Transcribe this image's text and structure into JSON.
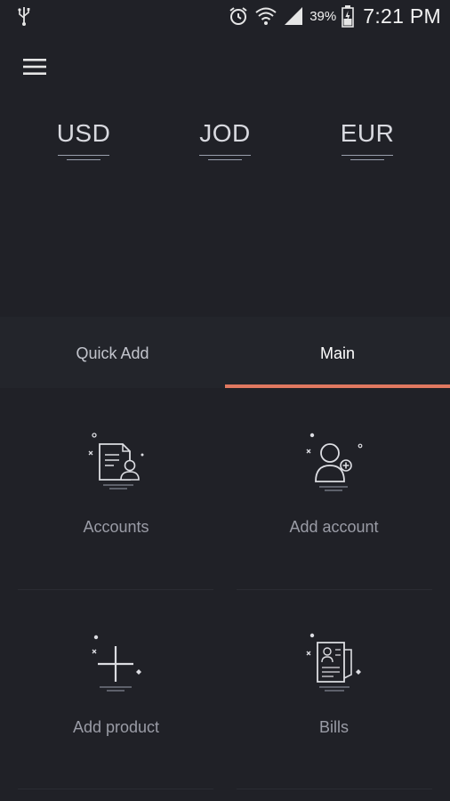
{
  "status_bar": {
    "battery_percent": "39%",
    "time": "7:21 PM",
    "icons": [
      "usb-icon",
      "alarm-icon",
      "wifi-icon",
      "signal-icon",
      "battery-icon"
    ]
  },
  "header": {
    "menu_icon": "hamburger-menu-icon",
    "currencies": [
      "USD",
      "JOD",
      "EUR"
    ]
  },
  "tabs": [
    {
      "label": "Quick Add",
      "active": false
    },
    {
      "label": "Main",
      "active": true
    }
  ],
  "colors": {
    "background": "#202127",
    "tab_background": "#23252b",
    "active_indicator": "#e07860",
    "label_muted": "#9a9ca6"
  },
  "grid_items": [
    {
      "label": "Accounts",
      "icon": "accounts-document-icon"
    },
    {
      "label": "Add account",
      "icon": "add-user-icon"
    },
    {
      "label": "Add product",
      "icon": "add-plus-icon"
    },
    {
      "label": "Bills",
      "icon": "bills-receipt-icon"
    }
  ]
}
